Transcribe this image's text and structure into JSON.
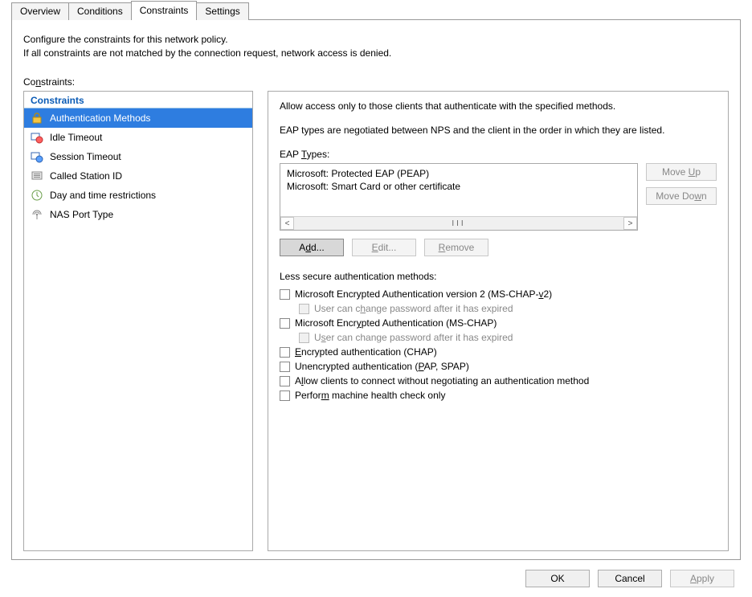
{
  "tabs": [
    "Overview",
    "Conditions",
    "Constraints",
    "Settings"
  ],
  "active_tab": 2,
  "description_line1": "Configure the constraints for this network policy.",
  "description_line2": "If all constraints are not matched by the connection request, network access is denied.",
  "constraints_label": "Constraints:",
  "left": {
    "header": "Constraints",
    "items": [
      {
        "label": "Authentication Methods",
        "icon": "lock-icon",
        "selected": true
      },
      {
        "label": "Idle Timeout",
        "icon": "idle-icon",
        "selected": false
      },
      {
        "label": "Session Timeout",
        "icon": "session-icon",
        "selected": false
      },
      {
        "label": "Called Station ID",
        "icon": "station-icon",
        "selected": false
      },
      {
        "label": "Day and time restrictions",
        "icon": "clock-icon",
        "selected": false
      },
      {
        "label": "NAS Port Type",
        "icon": "nas-icon",
        "selected": false
      }
    ]
  },
  "right": {
    "intro": "Allow access only to those clients that authenticate with the specified methods.",
    "eap_note": "EAP types are negotiated between NPS and the client in the order in which they are listed.",
    "eap_label": "EAP Types:",
    "eap_items": [
      "Microsoft: Protected EAP (PEAP)",
      "Microsoft: Smart Card or other certificate"
    ],
    "move_up": "Move Up",
    "move_down": "Move Down",
    "add": "Add...",
    "edit": "Edit...",
    "remove": "Remove",
    "less_secure_label": "Less secure authentication methods:",
    "chks": {
      "mschapv2": "Microsoft Encrypted Authentication version 2 (MS-CHAP-v2)",
      "mschapv2_sub": "User can change password after it has expired",
      "mschap": "Microsoft Encrypted Authentication (MS-CHAP)",
      "mschap_sub": "User can change password after it has expired",
      "chap": "Encrypted authentication (CHAP)",
      "pap": "Unencrypted authentication (PAP, SPAP)",
      "noauth": "Allow clients to connect without negotiating an authentication method",
      "machine": "Perform machine health check only"
    }
  },
  "footer": {
    "ok": "OK",
    "cancel": "Cancel",
    "apply": "Apply"
  }
}
